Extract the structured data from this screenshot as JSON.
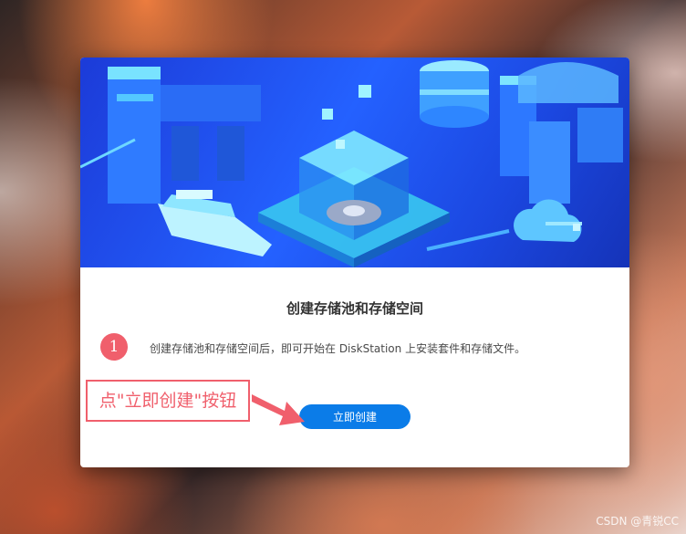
{
  "dialog": {
    "title": "创建存储池和存储空间",
    "description": "创建存储池和存储空间后，即可开始在 DiskStation 上安装套件和存储文件。",
    "create_button_label": "立即创建"
  },
  "annotation": {
    "step_number": "1",
    "callout_text": "点\"立即创建\"按钮",
    "accent_color": "#f05f6c"
  },
  "watermark": "CSDN @青锐CC",
  "colors": {
    "primary_button": "#0b7ce8",
    "hero_blue": "#2461ff"
  }
}
